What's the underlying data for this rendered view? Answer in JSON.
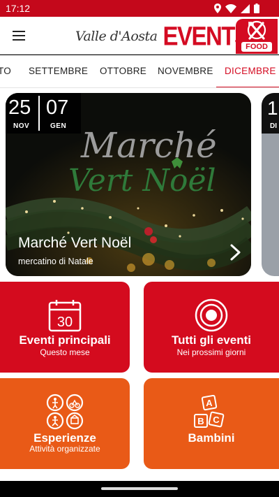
{
  "status_bar": {
    "time": "17:12"
  },
  "header": {
    "logo_script": "Valle d'Aosta",
    "logo_events": "EVENTS",
    "food_label": "FOOD"
  },
  "months": [
    "TO",
    "SETTEMBRE",
    "OTTOBRE",
    "NOVEMBRE",
    "DICEMBRE"
  ],
  "active_month": "DICEMBRE",
  "featured_event": {
    "start_day": "25",
    "start_month": "NOV",
    "end_day": "07",
    "end_month": "GEN",
    "poster_line1": "Marché",
    "poster_line2": "Vert Noël",
    "title": "Marché Vert Noël",
    "subtitle": "mercatino di Natale"
  },
  "next_event_peek": {
    "day": "1",
    "month": "DI"
  },
  "calendar_icon_number": "30",
  "tiles": [
    {
      "title": "Eventi principali",
      "subtitle": "Questo mese",
      "icon": "calendar-icon",
      "color": "#d40b1e"
    },
    {
      "title": "Tutti gli eventi",
      "subtitle": "Nei prossimi giorni",
      "icon": "target-icon",
      "color": "#d40b1e"
    },
    {
      "title": "Esperienze",
      "subtitle": "Attività organizzate",
      "icon": "activities-icon",
      "color": "#e95a17"
    },
    {
      "title": "Bambini",
      "subtitle": "",
      "icon": "abc-blocks-icon",
      "color": "#e95a17"
    }
  ],
  "colors": {
    "brand_red": "#d40b22",
    "tile_red": "#d40b1e",
    "tile_orange": "#e95a17"
  }
}
